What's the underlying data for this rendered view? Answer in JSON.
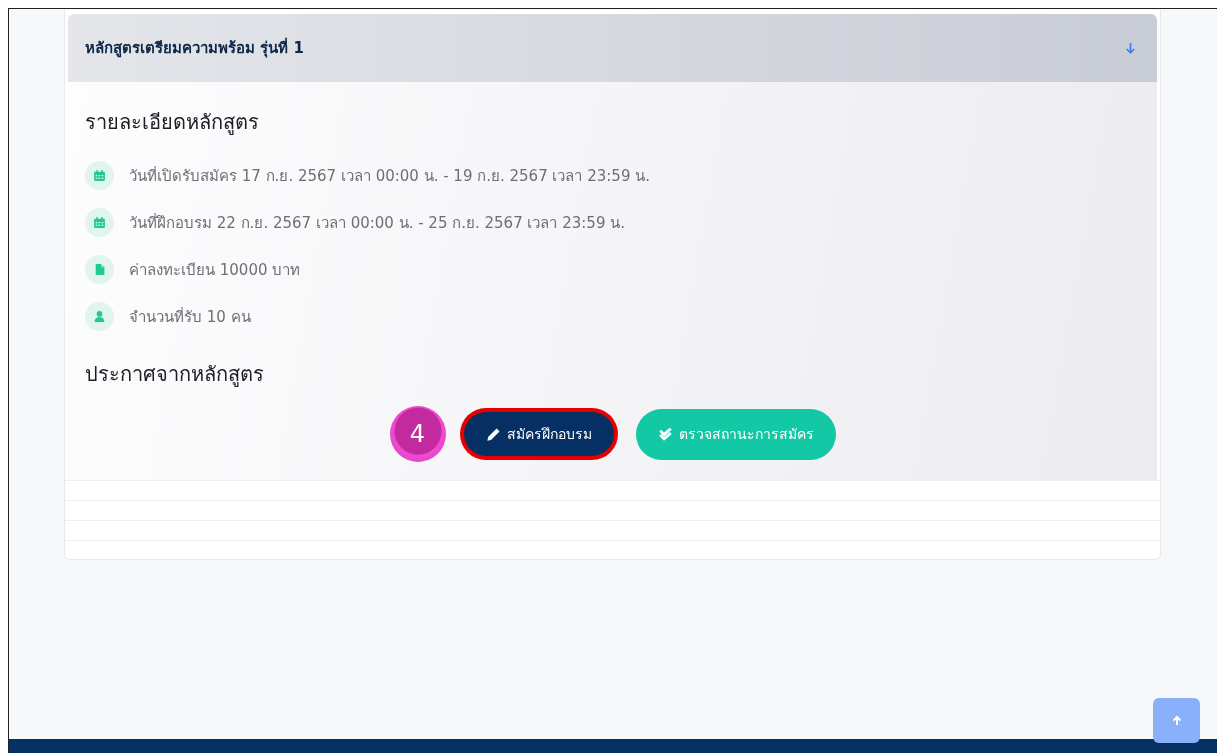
{
  "course": {
    "title": "หลักสูตรเตรียมความพร้อม รุ่นที่ 1",
    "expanded": true,
    "details_heading": "รายละเอียดหลักสูตร",
    "details": [
      {
        "kind": "calendar",
        "text": "วันที่เปิดรับสมัคร 17 ก.ย. 2567 เวลา 00:00 น. - 19 ก.ย. 2567 เวลา 23:59 น."
      },
      {
        "kind": "calendar",
        "text": "วันที่ฝึกอบรม 22 ก.ย. 2567 เวลา 00:00 น. - 25 ก.ย. 2567 เวลา 23:59 น."
      },
      {
        "kind": "file",
        "text": "ค่าลงทะเบียน 10000 บาท"
      },
      {
        "kind": "user",
        "text": "จำนวนที่รับ 10 คน"
      }
    ],
    "announcements_heading": "ประกาศจากหลักสูตร",
    "buttons": [
      {
        "kind": "apply",
        "label": "สมัครฝึกอบรม",
        "highlighted": true
      },
      {
        "kind": "status",
        "label": "ตรวจสถานะการสมัคร",
        "highlighted": false
      }
    ]
  },
  "step_marker": "4"
}
